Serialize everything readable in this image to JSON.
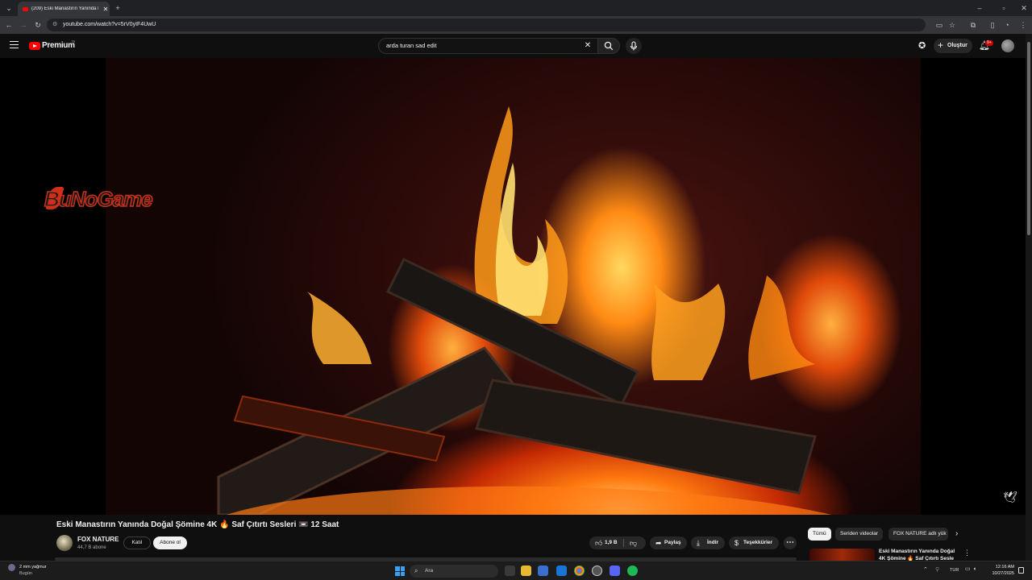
{
  "browser": {
    "tab_title": "(209) Eski Manastırın Yanında D",
    "url": "youtube.com/watch?v=5rV0yIF4UwU",
    "new_tab_symbol": "+",
    "close_symbol": "✕"
  },
  "masthead": {
    "brand": "Premium",
    "region_code": "TR",
    "search_query": "arda turan sad edit",
    "create_label": "Oluştur",
    "notification_badge": "9+"
  },
  "video": {
    "watermark": "BuNoGame",
    "title": "Eski Manastırın Yanında Doğal Şömine 4K 🔥 Saf Çıtırtı Sesleri 📼 12 Saat",
    "channel_name": "FOX NATURE",
    "subscriber_count": "44,7 B abone",
    "join_label": "Katıl",
    "subscribe_label": "Abone ol",
    "like_count": "1,9 B",
    "share_label": "Paylaş",
    "download_label": "İndir",
    "thanks_label": "Teşekkürler",
    "more_symbol": "⋯"
  },
  "sidebar": {
    "chips": [
      "Tümü",
      "Seriden videolar",
      "FOX NATURE adlı yük"
    ],
    "rec_title": "Eski Manastırın Yanında Doğal 4K Şömine 🔥 Saf Çıtırtı Sesle"
  },
  "taskbar": {
    "weather_line1": "2 mm yağmur",
    "weather_line2": "Bugün",
    "search_placeholder": "Ara",
    "language": "TUR",
    "time": "12:16 AM",
    "date": "10/27/2025"
  },
  "colors": {
    "brand_red": "#ff0000",
    "accent_blue": "#3aa0f5",
    "background": "#0f0f0f"
  },
  "icons": [
    "hamburger-icon",
    "search-icon",
    "mic-icon",
    "bell-icon",
    "like-icon",
    "dislike-icon",
    "share-icon",
    "download-icon",
    "thanks-icon"
  ]
}
